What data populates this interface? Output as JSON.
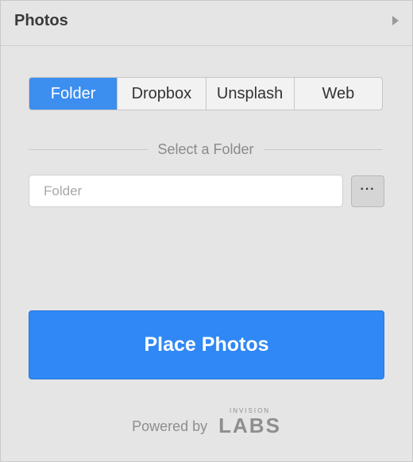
{
  "header": {
    "title": "Photos",
    "collapse_icon": "caret-right-icon"
  },
  "tabs": [
    {
      "label": "Folder",
      "active": true
    },
    {
      "label": "Dropbox",
      "active": false
    },
    {
      "label": "Unsplash",
      "active": false
    },
    {
      "label": "Web",
      "active": false
    }
  ],
  "section": {
    "label": "Select a Folder"
  },
  "folder_input": {
    "value": "",
    "placeholder": "Folder"
  },
  "browse_button": {
    "label": "···"
  },
  "place_button": {
    "label": "Place Photos"
  },
  "footer": {
    "powered_by": "Powered by",
    "brand_top": "INVISION",
    "brand_main": "LABS"
  },
  "colors": {
    "accent": "#3c8eef",
    "primary_button": "#2f88f5",
    "panel_bg": "#e5e5e5"
  }
}
